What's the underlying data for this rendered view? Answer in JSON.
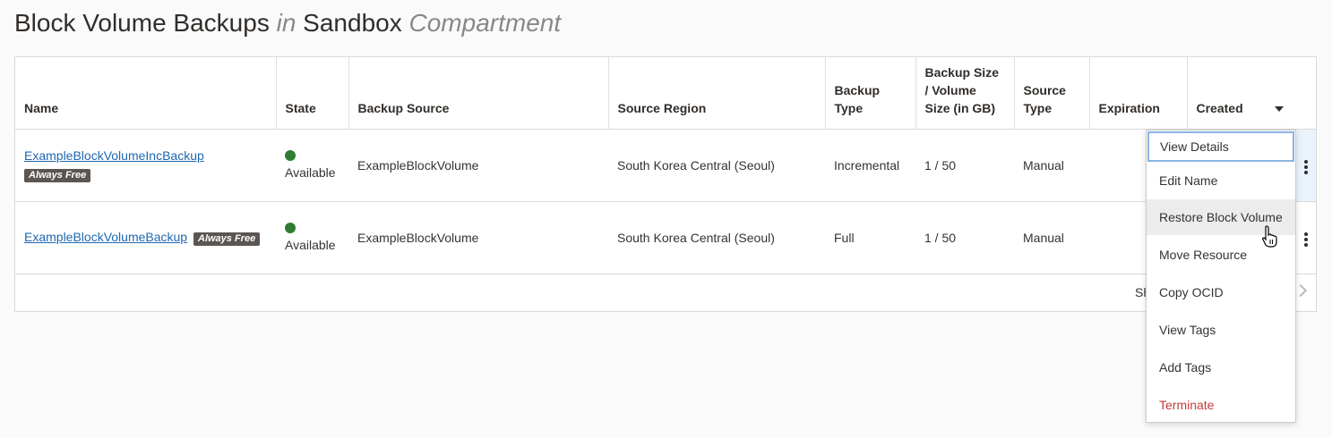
{
  "page": {
    "title_main": "Block Volume Backups",
    "title_in": "in",
    "title_compartment_name": "Sandbox",
    "title_compartment_label": "Compartment"
  },
  "table": {
    "columns": [
      "Name",
      "State",
      "Backup Source",
      "Source Region",
      "Backup Type",
      "Backup Size / Volume Size (in GB)",
      "Source Type",
      "Expiration",
      "Created"
    ],
    "rows": [
      {
        "name": "ExampleBlockVolumeIncBackup",
        "badge": "Always Free",
        "state": "Available",
        "backup_source": "ExampleBlockVolume",
        "source_region": "South Korea Central (Seoul)",
        "backup_type": "Incremental",
        "size": "1 / 50",
        "source_type": "Manual",
        "expiration": ""
      },
      {
        "name": "ExampleBlockVolumeBackup",
        "badge": "Always Free",
        "state": "Available",
        "backup_source": "ExampleBlockVolume",
        "source_region": "South Korea Central (Seoul)",
        "backup_type": "Full",
        "size": "1 / 50",
        "source_type": "Manual",
        "expiration": ""
      }
    ],
    "footer_text": "Sh"
  },
  "context_menu": {
    "items": [
      "View Details",
      "Edit Name",
      "Restore Block Volume",
      "Move Resource",
      "Copy OCID",
      "View Tags",
      "Add Tags",
      "Terminate"
    ]
  },
  "colors": {
    "link": "#1f67b0",
    "status_available": "#2e7d32",
    "danger": "#c23b3b",
    "badge_bg": "#5b5652"
  }
}
